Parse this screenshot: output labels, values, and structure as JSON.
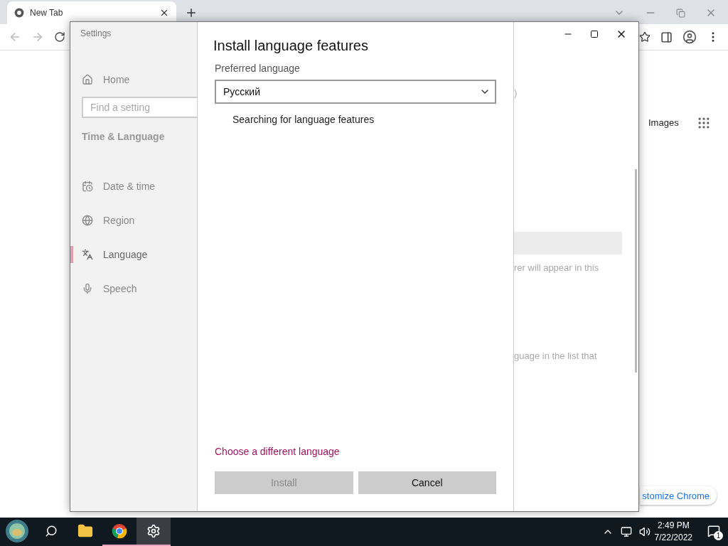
{
  "browser": {
    "tabs": [
      {
        "label": "New Tab",
        "selected": true
      }
    ],
    "links": [
      "Images"
    ],
    "customize_button": "stomize Chrome"
  },
  "settings_window": {
    "title": "Settings",
    "home": "Home",
    "search": {
      "placeholder": "Find a setting"
    },
    "section": "Time & Language",
    "items": [
      {
        "kind": "date",
        "label": "Date & time",
        "selected": false
      },
      {
        "kind": "region",
        "label": "Region",
        "selected": false
      },
      {
        "kind": "language",
        "label": "Language",
        "selected": true
      },
      {
        "kind": "speech",
        "label": "Speech",
        "selected": false
      }
    ],
    "background_texts": [
      ")",
      "rer will appear in this",
      "guage in the list that"
    ]
  },
  "dialog": {
    "title": "Install language features",
    "field_label": "Preferred language",
    "language_select": {
      "value": "Русский"
    },
    "status": "Searching for language features",
    "link": "Choose a different language",
    "buttons": [
      {
        "label": "Install",
        "disabled": true
      },
      {
        "label": "Cancel",
        "disabled": false
      }
    ]
  },
  "taskbar": {
    "apps": [
      {
        "kind": "explorer",
        "running": false,
        "selected": false
      },
      {
        "kind": "chrome",
        "running": true,
        "selected": false
      },
      {
        "kind": "settings",
        "running": true,
        "selected": true
      }
    ],
    "clock": {
      "time": "2:49 PM",
      "date": "7/22/2022"
    },
    "notification_count": "1"
  }
}
